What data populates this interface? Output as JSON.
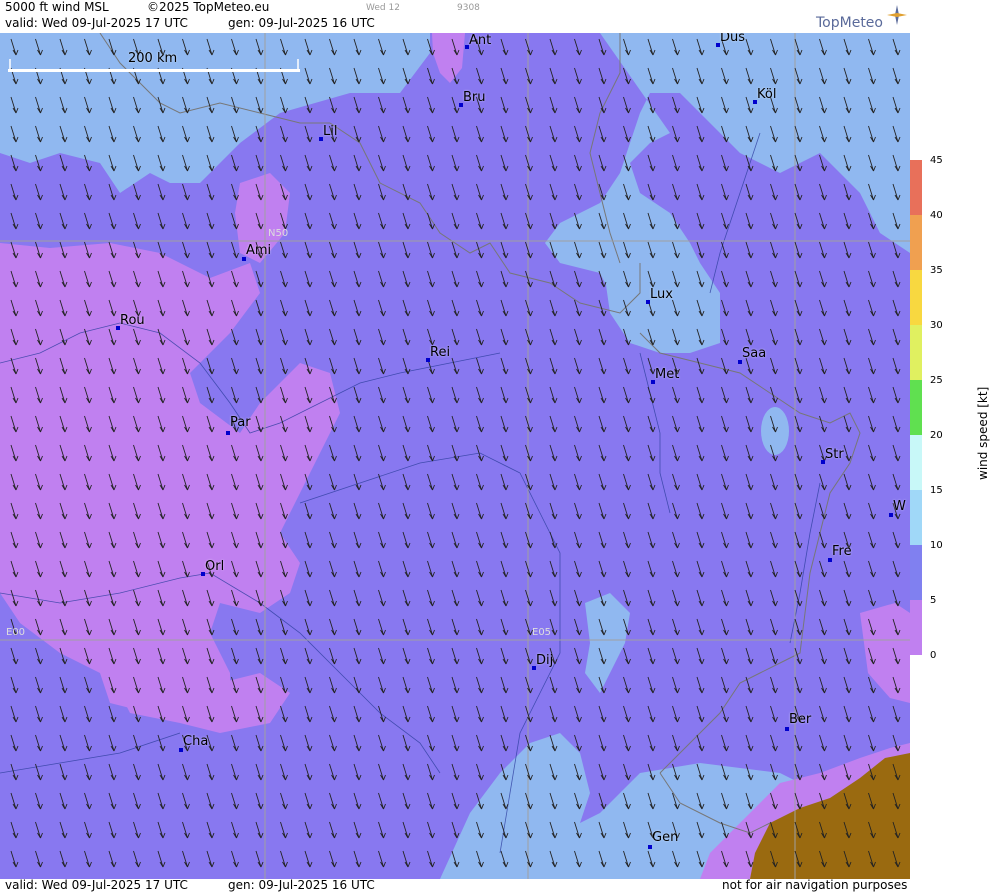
{
  "header": {
    "product": "5000 ft wind MSL",
    "copyright": "©2025 TopMeteo.eu",
    "valid": "valid:  Wed  09-Jul-2025  17 UTC",
    "gen": "gen: 09-Jul-2025 16 UTC",
    "small1": "Wed 12",
    "small2": "9308",
    "logo": "TopMeteo"
  },
  "footer": {
    "valid": "valid:  Wed  09-Jul-2025  17 UTC",
    "gen": "gen: 09-Jul-2025 16 UTC",
    "note": "not for air navigation purposes"
  },
  "scale_bar": {
    "label": "200 km"
  },
  "grid_labels": {
    "lat": "N50",
    "lon0": "E00",
    "lon5": "E05"
  },
  "cities": [
    {
      "name": "Ant"
    },
    {
      "name": "Düs"
    },
    {
      "name": "Bru"
    },
    {
      "name": "Köl"
    },
    {
      "name": "Lil"
    },
    {
      "name": "Ami"
    },
    {
      "name": "Rou"
    },
    {
      "name": "Lux"
    },
    {
      "name": "Rei"
    },
    {
      "name": "Saa"
    },
    {
      "name": "Met"
    },
    {
      "name": "Par"
    },
    {
      "name": "Str"
    },
    {
      "name": "W"
    },
    {
      "name": "Fre"
    },
    {
      "name": "Orl"
    },
    {
      "name": "Dij"
    },
    {
      "name": "Ber"
    },
    {
      "name": "Cha"
    },
    {
      "name": "Gen"
    }
  ],
  "colorbar": {
    "title": "wind  speed  [kt]",
    "ticks": [
      "45",
      "40",
      "35",
      "30",
      "25",
      "20",
      "15",
      "10",
      "5",
      "0"
    ],
    "colors": [
      "#e8705a",
      "#f0a050",
      "#f8d840",
      "#f8f850",
      "#c0f060",
      "#60e050",
      "#c8f8f8",
      "#a0d8f8",
      "#8080f0",
      "#c080f0"
    ]
  }
}
